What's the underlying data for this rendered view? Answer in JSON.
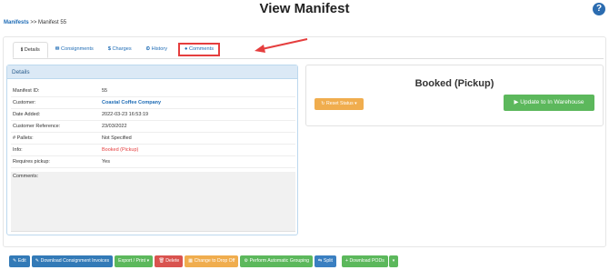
{
  "header": {
    "title": "View Manifest",
    "help_icon": "?"
  },
  "breadcrumb": {
    "link": "Manifests",
    "separator": ">>",
    "current": "Manifest 55"
  },
  "tabs": [
    {
      "icon": "ℹ",
      "label": "Details"
    },
    {
      "icon": "✉",
      "label": "Consignments"
    },
    {
      "icon": "$",
      "label": "Charges"
    },
    {
      "icon": "⏲",
      "label": "History"
    },
    {
      "icon": "●",
      "label": "Comments"
    }
  ],
  "details": {
    "title": "Details",
    "rows": [
      {
        "label": "Manifest ID:",
        "value": "55"
      },
      {
        "label": "Customer:",
        "value": "Coastal Coffee Company"
      },
      {
        "label": "Date Added:",
        "value": "2022-03-23 16:53:19"
      },
      {
        "label": "Customer Reference:",
        "value": "23/03/2022"
      },
      {
        "label": "# Pallets:",
        "value": "Not Specified"
      },
      {
        "label": "Info:",
        "value": "Booked (Pickup)"
      },
      {
        "label": "Requires pickup:",
        "value": "Yes"
      }
    ],
    "comments_label": "Comments:"
  },
  "status": {
    "title": "Booked (Pickup)",
    "reset_label": "Reset Status",
    "update_label": "Update to In Warehouse"
  },
  "toolbar": {
    "edit": "Edit",
    "download_invoices": "Download Consignment Invoices",
    "export_print": "Export / Print",
    "delete": "Delete",
    "change_drop_off": "Change to Drop Off",
    "auto_grouping": "Perform Automatic Grouping",
    "split": "Split",
    "download_pods": "Download PODs"
  },
  "colors": {
    "link": "#1d6bb5",
    "accent_red": "#e53e3e",
    "panel_header": "#dbe9f6",
    "success": "#5cb85c",
    "warning": "#f0ad4e",
    "danger": "#d9534f",
    "primary": "#337ab7"
  }
}
